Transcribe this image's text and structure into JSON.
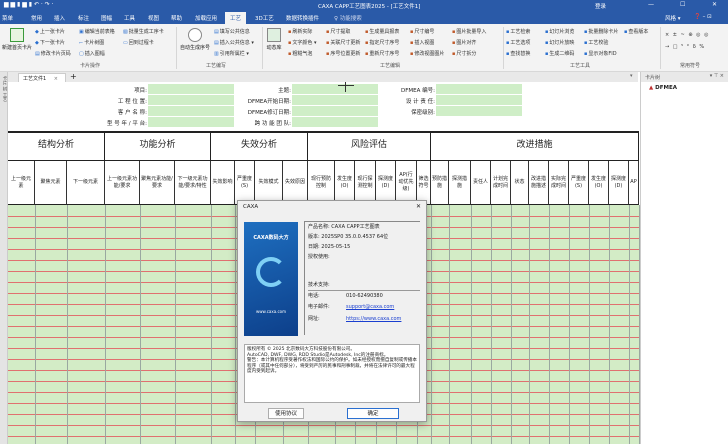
{
  "title": {
    "app": "CAXA CAPP工艺图表2025 - [工艺文件1]",
    "login": "登录",
    "min": "—",
    "max": "☐",
    "close": "✕"
  },
  "menu": {
    "items": [
      "菜单",
      "常用",
      "插入",
      "标注",
      "图幅",
      "工具",
      "视图",
      "帮助",
      "加载应用",
      "工艺",
      "3D工艺",
      "数据转换插件"
    ],
    "active": "工艺",
    "search": "♀ 功能搜索",
    "style": "风格 ▾"
  },
  "ribbon": {
    "card_ops": {
      "title": "卡片操作",
      "new_first": "新建首页卡片",
      "prev": "上一张卡片",
      "next": "下一张卡片",
      "edit_page": "修改卡片页码",
      "edit_table": "编辑当前表格",
      "card_tree": "卡片树图",
      "insert_frame": "插入图幅",
      "batch_gen": "批量生成工序卡",
      "back_proc": "回到过程卡"
    },
    "write": {
      "title": "工艺编写",
      "auto_seq": "自动生成序号",
      "fill_common": "填写公共信息",
      "insert_common": "插入公共信息 ▾",
      "ref_col": "引用所属栏 ▾"
    },
    "edit": {
      "title": "工艺编辑",
      "lib": "动态库",
      "items": [
        "刷新实际",
        "文字颜色 ▾",
        "粗糙气泡",
        "尺寸提取",
        "关联尺寸更新",
        "序号位置更新",
        "生成量具报表",
        "指定尺寸序号",
        "重新尺寸序号",
        "尺寸编号",
        "插入视图",
        "修改视图图片",
        "图片批量导入",
        "图片对齐",
        "尺寸拆分"
      ]
    },
    "tools": {
      "title": "工艺工具",
      "items": [
        "工艺检索",
        "工艺选项",
        "查找替换",
        "幻灯片浏览",
        "幻灯片放映",
        "生成二维码",
        "批量删除卡片",
        "工艺校验",
        "显示对象FID",
        "查看版本"
      ]
    },
    "symbols": {
      "title": "常用符号",
      "row1": "× ± ~ ⊕ ◎ ◎",
      "row2": "→ □ ⁵ ° δ %"
    }
  },
  "tab": {
    "label": "工艺文件1",
    "close": "×",
    "add": "+"
  },
  "panel": {
    "title": "卡片树",
    "root": "DFMEA"
  },
  "left_strip": [
    "卡片",
    "树",
    "工艺"
  ],
  "form": {
    "left": [
      "项目:",
      "工 程 位 置:",
      "客 户 名 称:",
      "型 号 年 / 平 台:"
    ],
    "mid": [
      "主题:",
      "DFMEA开始日期:",
      "DFMEA修订日期:",
      "跨 功 能 团 队:"
    ],
    "right": [
      "DFMEA 编号:",
      "设 计 责 任:",
      "保密级别:"
    ]
  },
  "table": {
    "groups": [
      "结构分析",
      "功能分析",
      "失效分析",
      "风险评估",
      "改进措施"
    ],
    "columns": [
      "上一级元素",
      "聚焦元素",
      "下一级元素",
      "上一级元素功能/要求",
      "聚焦元素功能/要求",
      "下一级元素功能/要求/特性",
      "失效影响",
      "严重度(S)",
      "失效模式",
      "失效原因",
      "现行预防控制",
      "发生度(O)",
      "现行探测控制",
      "探测度(D)",
      "AP(行动优先级)",
      "筛选符号",
      "预防措施",
      "探测措施",
      "责任人",
      "计划完成时间",
      "状态",
      "改进措施描述",
      "实际完成时间",
      "严重度(S)",
      "发生度(O)",
      "探测度(D)",
      "AP"
    ]
  },
  "dialog": {
    "title": "CAXA",
    "close": "✕",
    "logo": "CAXA数码大方",
    "url_logo": "www.caxa.com",
    "product": "产品名称: CAXA CAPP工艺图表",
    "version": "版本: 2025SP0 35.0.0.4537 64位",
    "date": "日期: 2025-05-15",
    "license": "授权使用:",
    "support": "技术支持:",
    "phone_label": "电话:",
    "phone": "010-62490380",
    "email_label": "电子邮件:",
    "email": "support@caxa.com",
    "web_label": "网址:",
    "web": "https://www.caxa.com",
    "copyright": "版权所有 © 2025 北京数码大方科技股份有限公司。\nAutoCAD, DWF, DWG, RDD Studio是Autodesk, Inc的注册商标。\n警告：本计算机程序受著作权法和国际公约的保护。如未经授权而擅自复制或传播本程序（或其中任何部分），将受到严厉的民事和刑事制裁，并将在法律许可的最大程度内受到起诉。",
    "agreement": "使用协议",
    "ok": "确定"
  },
  "colors": {
    "brand": "#2a5aa8",
    "field": "#cfeec7",
    "row_line": "#e07070"
  }
}
